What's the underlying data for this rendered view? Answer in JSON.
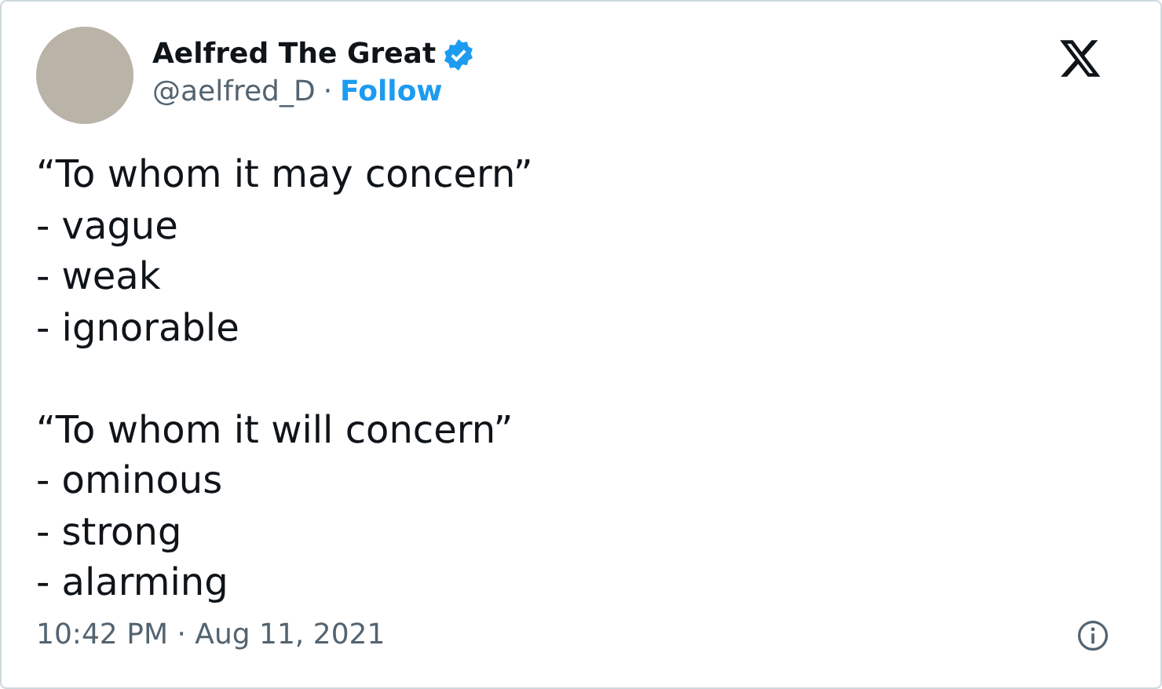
{
  "author": {
    "name": "Aelfred The Great",
    "verified": true,
    "handle": "@aelfred_D",
    "separator": "·",
    "follow": "Follow"
  },
  "text": "“To whom it may concern”\n- vague\n- weak\n- ignorable\n\n“To whom it will concern”\n- ominous\n- strong\n- alarming",
  "timestamp": "10:42 PM · Aug 11, 2021"
}
